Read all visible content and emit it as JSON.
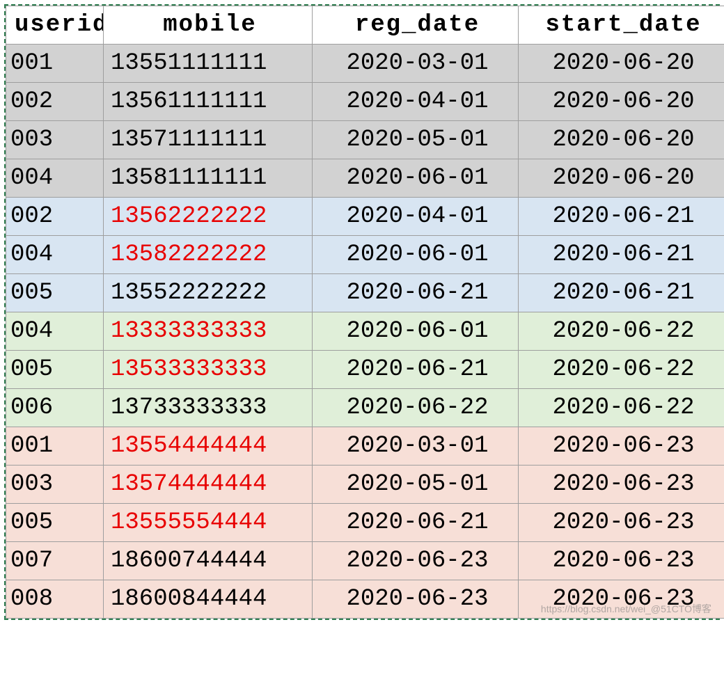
{
  "table": {
    "columns": {
      "userid": "userid",
      "mobile": "mobile",
      "reg_date": "reg_date",
      "start_date": "start_date"
    },
    "rows": [
      {
        "userid": "001",
        "mobile": "13551111111",
        "reg_date": "2020-03-01",
        "start_date": "2020-06-20",
        "group": "grey",
        "mobile_red": false
      },
      {
        "userid": "002",
        "mobile": "13561111111",
        "reg_date": "2020-04-01",
        "start_date": "2020-06-20",
        "group": "grey",
        "mobile_red": false
      },
      {
        "userid": "003",
        "mobile": "13571111111",
        "reg_date": "2020-05-01",
        "start_date": "2020-06-20",
        "group": "grey",
        "mobile_red": false
      },
      {
        "userid": "004",
        "mobile": "13581111111",
        "reg_date": "2020-06-01",
        "start_date": "2020-06-20",
        "group": "grey",
        "mobile_red": false
      },
      {
        "userid": "002",
        "mobile": "13562222222",
        "reg_date": "2020-04-01",
        "start_date": "2020-06-21",
        "group": "blue",
        "mobile_red": true
      },
      {
        "userid": "004",
        "mobile": "13582222222",
        "reg_date": "2020-06-01",
        "start_date": "2020-06-21",
        "group": "blue",
        "mobile_red": true
      },
      {
        "userid": "005",
        "mobile": "13552222222",
        "reg_date": "2020-06-21",
        "start_date": "2020-06-21",
        "group": "blue",
        "mobile_red": false
      },
      {
        "userid": "004",
        "mobile": "13333333333",
        "reg_date": "2020-06-01",
        "start_date": "2020-06-22",
        "group": "green",
        "mobile_red": true
      },
      {
        "userid": "005",
        "mobile": "13533333333",
        "reg_date": "2020-06-21",
        "start_date": "2020-06-22",
        "group": "green",
        "mobile_red": true
      },
      {
        "userid": "006",
        "mobile": "13733333333",
        "reg_date": "2020-06-22",
        "start_date": "2020-06-22",
        "group": "green",
        "mobile_red": false
      },
      {
        "userid": "001",
        "mobile": "13554444444",
        "reg_date": "2020-03-01",
        "start_date": "2020-06-23",
        "group": "peach",
        "mobile_red": true
      },
      {
        "userid": "003",
        "mobile": "13574444444",
        "reg_date": "2020-05-01",
        "start_date": "2020-06-23",
        "group": "peach",
        "mobile_red": true
      },
      {
        "userid": "005",
        "mobile": "13555554444",
        "reg_date": "2020-06-21",
        "start_date": "2020-06-23",
        "group": "peach",
        "mobile_red": true
      },
      {
        "userid": "007",
        "mobile": "18600744444",
        "reg_date": "2020-06-23",
        "start_date": "2020-06-23",
        "group": "peach",
        "mobile_red": false
      },
      {
        "userid": "008",
        "mobile": "18600844444",
        "reg_date": "2020-06-23",
        "start_date": "2020-06-23",
        "group": "peach",
        "mobile_red": false
      }
    ]
  },
  "colors": {
    "grey": "#d2d2d2",
    "blue": "#d8e5f2",
    "green": "#e0efd9",
    "peach": "#f7dfd7",
    "red_text": "#e80000"
  },
  "watermark": "https://blog.csdn.net/wei_@51CTO博客"
}
